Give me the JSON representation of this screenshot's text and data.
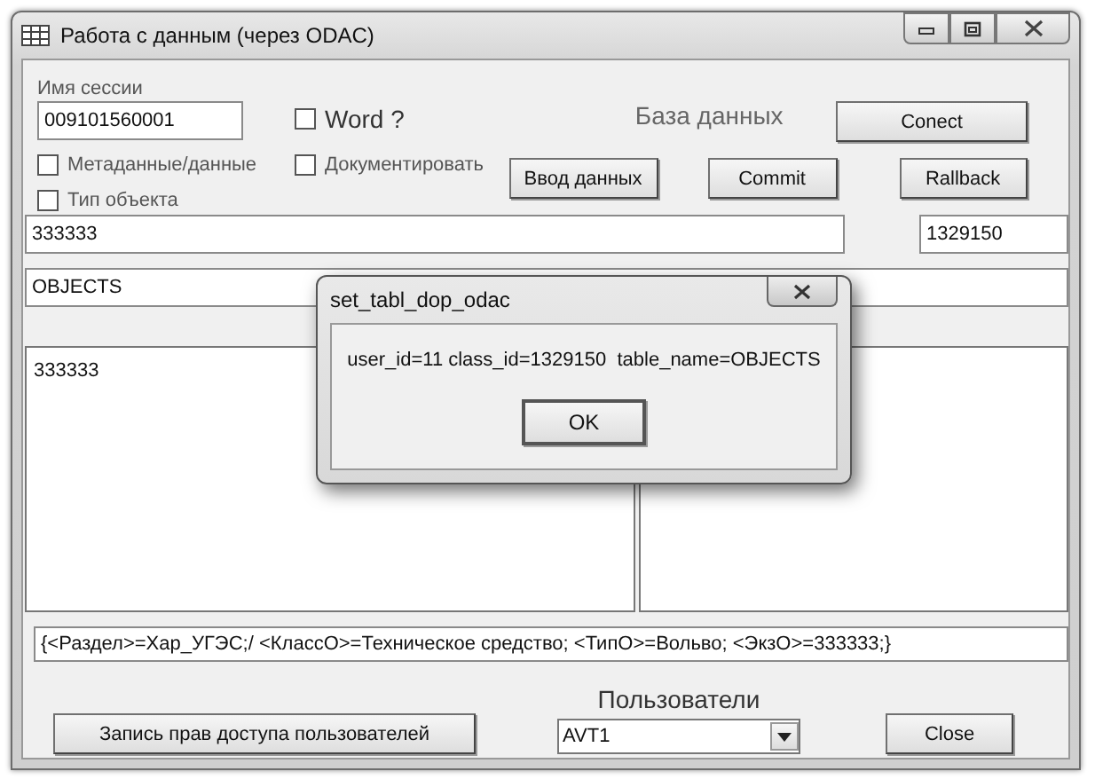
{
  "window": {
    "title": "Работа с данным (через ODAC)"
  },
  "session": {
    "label": "Имя сессии",
    "value": "009101560001"
  },
  "checkboxes": [
    {
      "label": "Word ?",
      "checked": false
    },
    {
      "label": "Метаданные/данные",
      "checked": false
    },
    {
      "label": "Документировать",
      "checked": false
    },
    {
      "label": "Тип объекта",
      "checked": false
    }
  ],
  "database_label": "База данных",
  "connect_button": "Conect",
  "input_button": "Ввод данных",
  "commit_button": "Commit",
  "rollback_button": "Rallback",
  "object_field": {
    "value": "333333"
  },
  "class_field": {
    "value": "1329150"
  },
  "table_field": {
    "value": "OBJECTS"
  },
  "left_list": {
    "items": [
      "333333"
    ]
  },
  "path_field": {
    "value": "{<Раздел>=Хар_УГЭС;/ <КлассО>=Техническое средство; <ТипО>=Вольво; <ЭкзО>=333333;}"
  },
  "users": {
    "label": "Пользователи",
    "value": "AVT1"
  },
  "access_button": "Запись прав доступа пользователей",
  "close_button": "Close",
  "dialog": {
    "title": "set_tabl_dop_odac",
    "message": "user_id=11 class_id=1329150  table_name=OBJECTS",
    "button": "OK"
  }
}
